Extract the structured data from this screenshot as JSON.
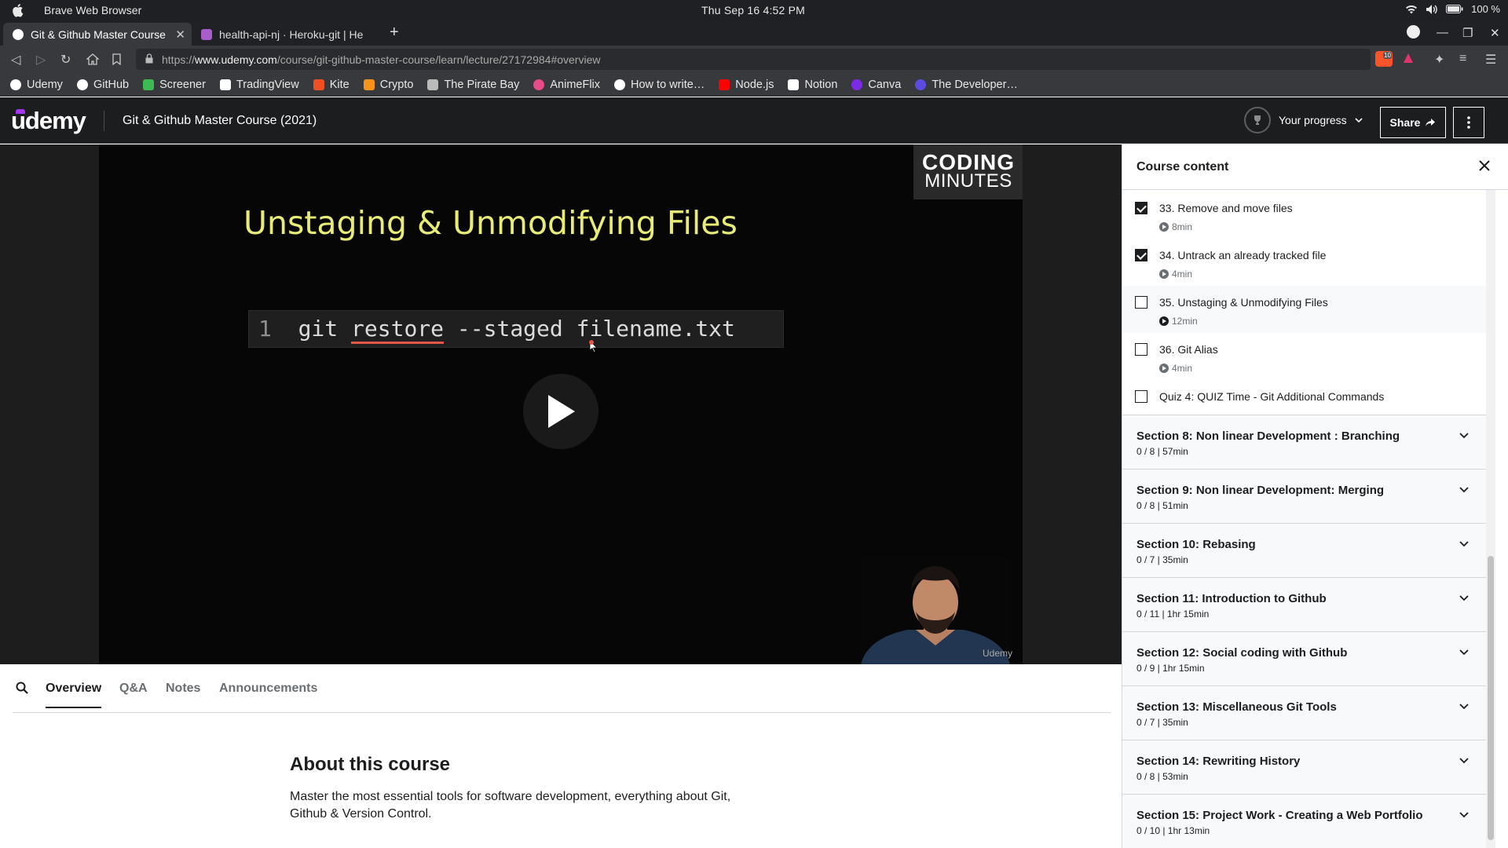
{
  "os": {
    "app_name": "Brave Web Browser",
    "clock": "Thu Sep 16   4:52 PM",
    "battery": "100 %"
  },
  "browser": {
    "tabs": [
      {
        "label": "Git & Github Master Course",
        "active": true
      },
      {
        "label": "health-api-nj · Heroku-git | He",
        "active": false
      }
    ],
    "url_prefix": "https://",
    "url_host": "www.udemy.com",
    "url_path": "/course/git-github-master-course/learn/lecture/27172984#overview",
    "shield_badge": "10",
    "bookmarks": [
      {
        "label": "Udemy",
        "color": "#ffffff"
      },
      {
        "label": "GitHub",
        "color": "#ffffff"
      },
      {
        "label": "Screener",
        "color": "#3cba54"
      },
      {
        "label": "TradingView",
        "color": "#ffffff"
      },
      {
        "label": "Kite",
        "color": "#f04e23"
      },
      {
        "label": "Crypto",
        "color": "#f7931a"
      },
      {
        "label": "The Pirate Bay",
        "color": "#bbbbbb"
      },
      {
        "label": "AnimeFlix",
        "color": "#e84a8a"
      },
      {
        "label": "How to write…",
        "color": "#ffffff"
      },
      {
        "label": "Node.js",
        "color": "#ff0000"
      },
      {
        "label": "Notion",
        "color": "#ffffff"
      },
      {
        "label": "Canva",
        "color": "#7d2ae8"
      },
      {
        "label": "The Developer…",
        "color": "#5b4be0"
      }
    ]
  },
  "header": {
    "logo": "Udemy",
    "course_title": "Git & Github Master Course (2021)",
    "progress_label": "Your progress",
    "share_label": "Share"
  },
  "video": {
    "slide_title": "Unstaging & Unmodifying Files",
    "code_line_no": "1",
    "code_cmd": "git ",
    "code_kw": "restore",
    "code_rest": " --staged filename.txt",
    "brand_line1": "CODING",
    "brand_line2": "MINUTES",
    "watermark": "Udemy"
  },
  "tabs": {
    "overview": "Overview",
    "qa": "Q&A",
    "notes": "Notes",
    "announcements": "Announcements"
  },
  "about": {
    "heading": "About this course",
    "description": "Master the most essential tools for software development, everything about Git, Github & Version Control."
  },
  "sidebar": {
    "title": "Course content",
    "lectures": [
      {
        "title": "33. Remove and move files",
        "duration": "8min",
        "done": true,
        "current": false
      },
      {
        "title": "34. Untrack an already tracked file",
        "duration": "4min",
        "done": true,
        "current": false
      },
      {
        "title": "35. Unstaging & Unmodifying Files",
        "duration": "12min",
        "done": false,
        "current": true
      },
      {
        "title": "36. Git Alias",
        "duration": "4min",
        "done": false,
        "current": false
      },
      {
        "title": "Quiz 4: QUIZ Time - Git Additional Commands",
        "duration": "",
        "done": false,
        "current": false
      }
    ],
    "sections": [
      {
        "title": "Section 8: Non linear Development : Branching",
        "meta": "0 / 8 | 57min"
      },
      {
        "title": "Section 9: Non linear Development: Merging",
        "meta": "0 / 8 | 51min"
      },
      {
        "title": "Section 10: Rebasing",
        "meta": "0 / 7 | 35min"
      },
      {
        "title": "Section 11: Introduction to Github",
        "meta": "0 / 11 | 1hr 15min"
      },
      {
        "title": "Section 12: Social coding with Github",
        "meta": "0 / 9 | 1hr 15min"
      },
      {
        "title": "Section 13: Miscellaneous Git Tools",
        "meta": "0 / 7 | 35min"
      },
      {
        "title": "Section 14: Rewriting History",
        "meta": "0 / 8 | 53min"
      },
      {
        "title": "Section 15: Project Work - Creating a Web Portfolio",
        "meta": "0 / 10 | 1hr 13min"
      }
    ]
  }
}
